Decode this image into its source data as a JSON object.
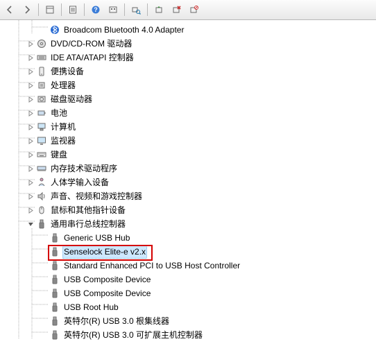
{
  "toolbar": {
    "back": "back",
    "forward": "forward",
    "properties": "properties",
    "refresh": "refresh",
    "help": "help",
    "scan": "scan-hardware",
    "view1": "view-1",
    "view2": "view-2",
    "view3": "view-3",
    "view4": "view-4"
  },
  "tree": {
    "items": [
      {
        "indent": 3,
        "exp": "none",
        "icon": "bluetooth",
        "label": "Broadcom Bluetooth 4.0 Adapter"
      },
      {
        "indent": 2,
        "exp": "closed",
        "icon": "disc",
        "label": "DVD/CD-ROM 驱动器"
      },
      {
        "indent": 2,
        "exp": "closed",
        "icon": "ide",
        "label": "IDE ATA/ATAPI 控制器"
      },
      {
        "indent": 2,
        "exp": "closed",
        "icon": "portable",
        "label": "便携设备"
      },
      {
        "indent": 2,
        "exp": "closed",
        "icon": "cpu",
        "label": "处理器"
      },
      {
        "indent": 2,
        "exp": "closed",
        "icon": "disk",
        "label": "磁盘驱动器"
      },
      {
        "indent": 2,
        "exp": "closed",
        "icon": "battery",
        "label": "电池"
      },
      {
        "indent": 2,
        "exp": "closed",
        "icon": "computer",
        "label": "计算机"
      },
      {
        "indent": 2,
        "exp": "closed",
        "icon": "monitor",
        "label": "监视器"
      },
      {
        "indent": 2,
        "exp": "closed",
        "icon": "keyboard",
        "label": "键盘"
      },
      {
        "indent": 2,
        "exp": "closed",
        "icon": "memory",
        "label": "内存技术驱动程序"
      },
      {
        "indent": 2,
        "exp": "closed",
        "icon": "hid",
        "label": "人体学输入设备"
      },
      {
        "indent": 2,
        "exp": "closed",
        "icon": "sound",
        "label": "声音、视频和游戏控制器"
      },
      {
        "indent": 2,
        "exp": "closed",
        "icon": "mouse",
        "label": "鼠标和其他指针设备"
      },
      {
        "indent": 2,
        "exp": "open",
        "icon": "usb",
        "label": "通用串行总线控制器"
      },
      {
        "indent": 3,
        "exp": "none",
        "icon": "usb",
        "label": "Generic USB Hub"
      },
      {
        "indent": 3,
        "exp": "none",
        "icon": "usb",
        "label": "Senselock Elite-e v2.x",
        "selected": true,
        "highlighted": true
      },
      {
        "indent": 3,
        "exp": "none",
        "icon": "usb",
        "label": "Standard Enhanced PCI to USB Host Controller"
      },
      {
        "indent": 3,
        "exp": "none",
        "icon": "usb",
        "label": "USB Composite Device"
      },
      {
        "indent": 3,
        "exp": "none",
        "icon": "usb",
        "label": "USB Composite Device"
      },
      {
        "indent": 3,
        "exp": "none",
        "icon": "usb",
        "label": "USB Root Hub"
      },
      {
        "indent": 3,
        "exp": "none",
        "icon": "usb",
        "label": "英特尔(R) USB 3.0 根集线器"
      },
      {
        "indent": 3,
        "exp": "none",
        "icon": "usb",
        "label": "英特尔(R) USB 3.0 可扩展主机控制器"
      }
    ]
  }
}
